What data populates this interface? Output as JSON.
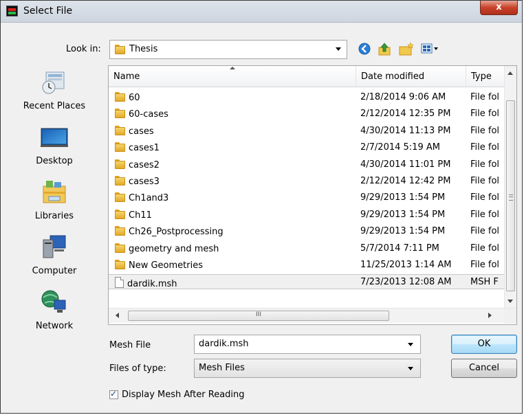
{
  "window": {
    "title": "Select File",
    "close_glyph": "x"
  },
  "toolbar": {
    "look_in_label": "Look in:",
    "look_in_value": "Thesis",
    "icons": [
      "back-icon",
      "up-folder-icon",
      "new-folder-icon",
      "view-menu-icon"
    ]
  },
  "places": [
    {
      "label": "Recent Places",
      "icon": "recent-places-icon"
    },
    {
      "label": "Desktop",
      "icon": "desktop-icon"
    },
    {
      "label": "Libraries",
      "icon": "libraries-icon"
    },
    {
      "label": "Computer",
      "icon": "computer-icon"
    },
    {
      "label": "Network",
      "icon": "network-icon"
    }
  ],
  "columns": [
    "Name",
    "Date modified",
    "Type"
  ],
  "files": [
    {
      "name": "60",
      "date": "2/18/2014 9:06 AM",
      "type": "File fol",
      "kind": "folder"
    },
    {
      "name": "60-cases",
      "date": "2/12/2014 12:35 PM",
      "type": "File fol",
      "kind": "folder"
    },
    {
      "name": "cases",
      "date": "4/30/2014 11:13 PM",
      "type": "File fol",
      "kind": "folder"
    },
    {
      "name": "cases1",
      "date": "2/7/2014 5:19 AM",
      "type": "File fol",
      "kind": "folder"
    },
    {
      "name": "cases2",
      "date": "4/30/2014 11:01 PM",
      "type": "File fol",
      "kind": "folder"
    },
    {
      "name": "cases3",
      "date": "2/12/2014 12:42 PM",
      "type": "File fol",
      "kind": "folder"
    },
    {
      "name": "Ch1and3",
      "date": "9/29/2013 1:54 PM",
      "type": "File fol",
      "kind": "folder"
    },
    {
      "name": "Ch11",
      "date": "9/29/2013 1:54 PM",
      "type": "File fol",
      "kind": "folder"
    },
    {
      "name": "Ch26_Postprocessing",
      "date": "9/29/2013 1:54 PM",
      "type": "File fol",
      "kind": "folder"
    },
    {
      "name": "geometry and mesh",
      "date": "5/7/2014 7:11 PM",
      "type": "File fol",
      "kind": "folder"
    },
    {
      "name": "New Geometries",
      "date": "11/25/2013 1:14 AM",
      "type": "File fol",
      "kind": "folder"
    },
    {
      "name": "dardik.msh",
      "date": "7/23/2013 12:08 AM",
      "type": "MSH F",
      "kind": "file",
      "selected": true
    }
  ],
  "hscroll_grip": "III",
  "form": {
    "mesh_file_label": "Mesh File",
    "mesh_file_value": "dardik.msh",
    "files_of_type_label": "Files of type:",
    "files_of_type_value": "Mesh Files",
    "ok_label": "OK",
    "cancel_label": "Cancel",
    "display_mesh_label": "Display Mesh After Reading",
    "display_mesh_checked": true
  },
  "colors": {
    "folder": "#e3a928",
    "close": "#c7432a",
    "default_button": "#bee6fd"
  }
}
